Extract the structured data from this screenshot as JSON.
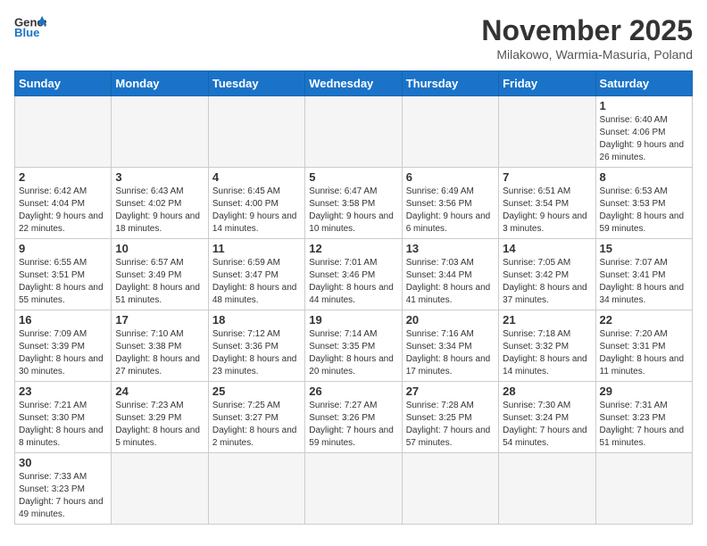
{
  "logo": {
    "text_general": "General",
    "text_blue": "Blue"
  },
  "header": {
    "month_year": "November 2025",
    "location": "Milakowo, Warmia-Masuria, Poland"
  },
  "weekdays": [
    "Sunday",
    "Monday",
    "Tuesday",
    "Wednesday",
    "Thursday",
    "Friday",
    "Saturday"
  ],
  "days": [
    {
      "date": "",
      "info": ""
    },
    {
      "date": "",
      "info": ""
    },
    {
      "date": "",
      "info": ""
    },
    {
      "date": "",
      "info": ""
    },
    {
      "date": "",
      "info": ""
    },
    {
      "date": "",
      "info": ""
    },
    {
      "date": "1",
      "info": "Sunrise: 6:40 AM\nSunset: 4:06 PM\nDaylight: 9 hours and 26 minutes."
    },
    {
      "date": "2",
      "info": "Sunrise: 6:42 AM\nSunset: 4:04 PM\nDaylight: 9 hours and 22 minutes."
    },
    {
      "date": "3",
      "info": "Sunrise: 6:43 AM\nSunset: 4:02 PM\nDaylight: 9 hours and 18 minutes."
    },
    {
      "date": "4",
      "info": "Sunrise: 6:45 AM\nSunset: 4:00 PM\nDaylight: 9 hours and 14 minutes."
    },
    {
      "date": "5",
      "info": "Sunrise: 6:47 AM\nSunset: 3:58 PM\nDaylight: 9 hours and 10 minutes."
    },
    {
      "date": "6",
      "info": "Sunrise: 6:49 AM\nSunset: 3:56 PM\nDaylight: 9 hours and 6 minutes."
    },
    {
      "date": "7",
      "info": "Sunrise: 6:51 AM\nSunset: 3:54 PM\nDaylight: 9 hours and 3 minutes."
    },
    {
      "date": "8",
      "info": "Sunrise: 6:53 AM\nSunset: 3:53 PM\nDaylight: 8 hours and 59 minutes."
    },
    {
      "date": "9",
      "info": "Sunrise: 6:55 AM\nSunset: 3:51 PM\nDaylight: 8 hours and 55 minutes."
    },
    {
      "date": "10",
      "info": "Sunrise: 6:57 AM\nSunset: 3:49 PM\nDaylight: 8 hours and 51 minutes."
    },
    {
      "date": "11",
      "info": "Sunrise: 6:59 AM\nSunset: 3:47 PM\nDaylight: 8 hours and 48 minutes."
    },
    {
      "date": "12",
      "info": "Sunrise: 7:01 AM\nSunset: 3:46 PM\nDaylight: 8 hours and 44 minutes."
    },
    {
      "date": "13",
      "info": "Sunrise: 7:03 AM\nSunset: 3:44 PM\nDaylight: 8 hours and 41 minutes."
    },
    {
      "date": "14",
      "info": "Sunrise: 7:05 AM\nSunset: 3:42 PM\nDaylight: 8 hours and 37 minutes."
    },
    {
      "date": "15",
      "info": "Sunrise: 7:07 AM\nSunset: 3:41 PM\nDaylight: 8 hours and 34 minutes."
    },
    {
      "date": "16",
      "info": "Sunrise: 7:09 AM\nSunset: 3:39 PM\nDaylight: 8 hours and 30 minutes."
    },
    {
      "date": "17",
      "info": "Sunrise: 7:10 AM\nSunset: 3:38 PM\nDaylight: 8 hours and 27 minutes."
    },
    {
      "date": "18",
      "info": "Sunrise: 7:12 AM\nSunset: 3:36 PM\nDaylight: 8 hours and 23 minutes."
    },
    {
      "date": "19",
      "info": "Sunrise: 7:14 AM\nSunset: 3:35 PM\nDaylight: 8 hours and 20 minutes."
    },
    {
      "date": "20",
      "info": "Sunrise: 7:16 AM\nSunset: 3:34 PM\nDaylight: 8 hours and 17 minutes."
    },
    {
      "date": "21",
      "info": "Sunrise: 7:18 AM\nSunset: 3:32 PM\nDaylight: 8 hours and 14 minutes."
    },
    {
      "date": "22",
      "info": "Sunrise: 7:20 AM\nSunset: 3:31 PM\nDaylight: 8 hours and 11 minutes."
    },
    {
      "date": "23",
      "info": "Sunrise: 7:21 AM\nSunset: 3:30 PM\nDaylight: 8 hours and 8 minutes."
    },
    {
      "date": "24",
      "info": "Sunrise: 7:23 AM\nSunset: 3:29 PM\nDaylight: 8 hours and 5 minutes."
    },
    {
      "date": "25",
      "info": "Sunrise: 7:25 AM\nSunset: 3:27 PM\nDaylight: 8 hours and 2 minutes."
    },
    {
      "date": "26",
      "info": "Sunrise: 7:27 AM\nSunset: 3:26 PM\nDaylight: 7 hours and 59 minutes."
    },
    {
      "date": "27",
      "info": "Sunrise: 7:28 AM\nSunset: 3:25 PM\nDaylight: 7 hours and 57 minutes."
    },
    {
      "date": "28",
      "info": "Sunrise: 7:30 AM\nSunset: 3:24 PM\nDaylight: 7 hours and 54 minutes."
    },
    {
      "date": "29",
      "info": "Sunrise: 7:31 AM\nSunset: 3:23 PM\nDaylight: 7 hours and 51 minutes."
    },
    {
      "date": "30",
      "info": "Sunrise: 7:33 AM\nSunset: 3:23 PM\nDaylight: 7 hours and 49 minutes."
    }
  ]
}
